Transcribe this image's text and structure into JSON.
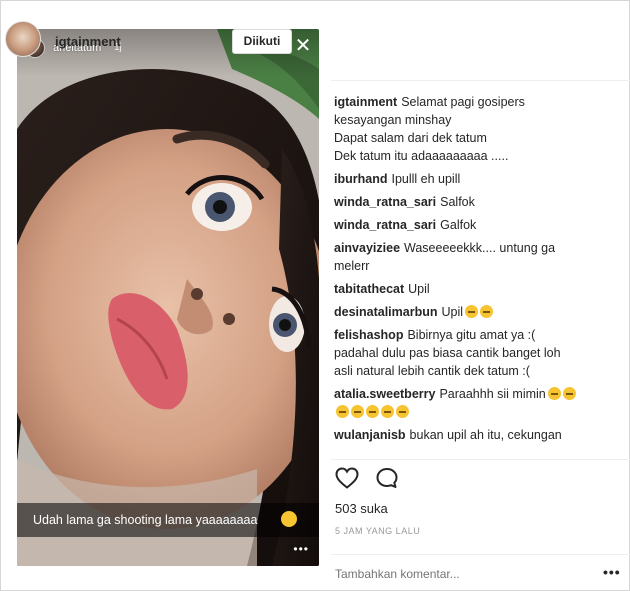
{
  "story": {
    "username": "arieltatum",
    "time": "1j",
    "close_glyph": "✕",
    "caption": "Udah lama ga shooting lama yaaaaaaaa",
    "caption_emoji": "hugging-face-emoji",
    "more_glyph": "•••"
  },
  "header": {
    "username": "igtainment",
    "follow_label": "Diikuti"
  },
  "comments": [
    {
      "user": "igtainment",
      "lines": [
        "Selamat pagi gosipers",
        "kesayangan minshay",
        "Dapat salam dari dek tatum",
        "Dek tatum itu adaaaaaaaaa ....."
      ]
    },
    {
      "user": "iburhand",
      "lines": [
        "Ipulll eh upill"
      ]
    },
    {
      "user": "winda_ratna_sari",
      "lines": [
        "Salfok"
      ]
    },
    {
      "user": "winda_ratna_sari",
      "lines": [
        "Galfok"
      ]
    },
    {
      "user": "ainvayiziee",
      "lines": [
        "Waseeeeekkk.... untung ga",
        "melerr"
      ]
    },
    {
      "user": "tabitathecat",
      "lines": [
        "Upil"
      ]
    },
    {
      "user": "desinatalimarbun",
      "lines": [
        "Upil"
      ],
      "emoji_count": 2
    },
    {
      "user": "felishashop",
      "lines": [
        "Bibirnya gitu amat ya :(",
        "padahal dulu pas biasa cantik banget loh",
        "asli natural lebih cantik dek tatum :("
      ]
    },
    {
      "user": "atalia.sweetberry",
      "lines": [
        "Paraahhh sii mimin"
      ],
      "emoji_count": 2,
      "extra_emoji_line": 5
    },
    {
      "user": "wulanjanisb",
      "lines": [
        "bukan upil ah itu, cekungan"
      ]
    }
  ],
  "likes": "503 suka",
  "timestamp": "5 JAM YANG LALU",
  "add_comment": {
    "placeholder": "Tambahkan komentar..."
  },
  "more_options": "•••",
  "icons": {
    "like": "heart-icon",
    "comment": "comment-bubble-icon",
    "close": "close-icon"
  }
}
